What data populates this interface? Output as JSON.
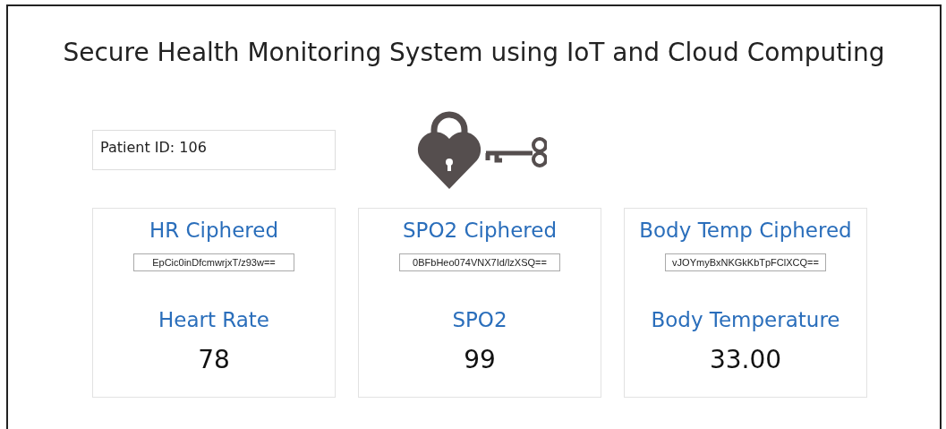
{
  "title": "Secure Health Monitoring System using IoT and Cloud Computing",
  "patient": {
    "label": "Patient ID: 106"
  },
  "cards": [
    {
      "cipher_label": "HR Ciphered",
      "cipher_value": "EpCic0inDfcmwrjxT/z93w==",
      "reading_label": "Heart Rate",
      "reading": "78"
    },
    {
      "cipher_label": "SPO2 Ciphered",
      "cipher_value": "0BFbHeo074VNX7Id/lzXSQ==",
      "reading_label": "SPO2",
      "reading": "99"
    },
    {
      "cipher_label": "Body Temp Ciphered",
      "cipher_value": "vJOYmyBxNKGkKbTpFClXCQ==",
      "reading_label": "Body Temperature",
      "reading": "33.00"
    }
  ]
}
